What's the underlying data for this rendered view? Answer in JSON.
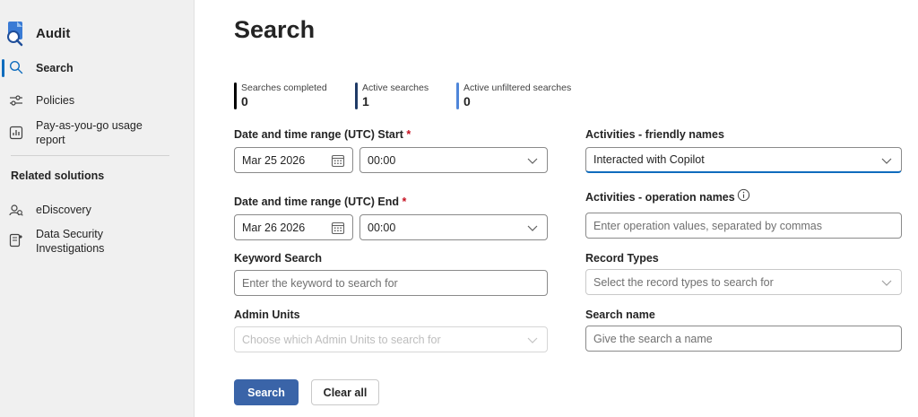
{
  "sidebar": {
    "app_title": "Audit",
    "items": [
      {
        "label": "Search",
        "icon": "search-icon",
        "active": true
      },
      {
        "label": "Policies",
        "icon": "sliders-icon"
      },
      {
        "label": "Pay-as-you-go usage report",
        "icon": "chart-icon"
      }
    ],
    "related_title": "Related solutions",
    "related_items": [
      {
        "label": "eDiscovery",
        "icon": "ediscovery-icon"
      },
      {
        "label": "Data Security Investigations",
        "icon": "investigation-icon"
      }
    ]
  },
  "main": {
    "title": "Search",
    "stats": [
      {
        "label": "Searches completed",
        "value": "0",
        "color": "#000000"
      },
      {
        "label": "Active searches",
        "value": "1",
        "color": "#1f3a66"
      },
      {
        "label": "Active unfiltered searches",
        "value": "0",
        "color": "#4f86d9"
      }
    ],
    "start": {
      "label": "Date and time range (UTC) Start",
      "required": "*",
      "date": "Mar 25 2026",
      "time": "00:00"
    },
    "end": {
      "label": "Date and time range (UTC) End",
      "required": "*",
      "date": "Mar 26 2026",
      "time": "00:00"
    },
    "keyword": {
      "label": "Keyword Search",
      "placeholder": "Enter the keyword to search for"
    },
    "admin_units": {
      "label": "Admin Units",
      "placeholder": "Choose which Admin Units to search for"
    },
    "activities_friendly": {
      "label": "Activities - friendly names",
      "value": "Interacted with Copilot"
    },
    "activities_operation": {
      "label": "Activities - operation names",
      "placeholder": "Enter operation values, separated by commas"
    },
    "record_types": {
      "label": "Record Types",
      "placeholder": "Select the record types to search for"
    },
    "search_name": {
      "label": "Search name",
      "placeholder": "Give the search a name"
    },
    "buttons": {
      "search": "Search",
      "clear": "Clear all"
    }
  },
  "colors": {
    "accent": "#0f6cbd",
    "primary_button": "#3a64a8",
    "required": "#c50f1f"
  }
}
